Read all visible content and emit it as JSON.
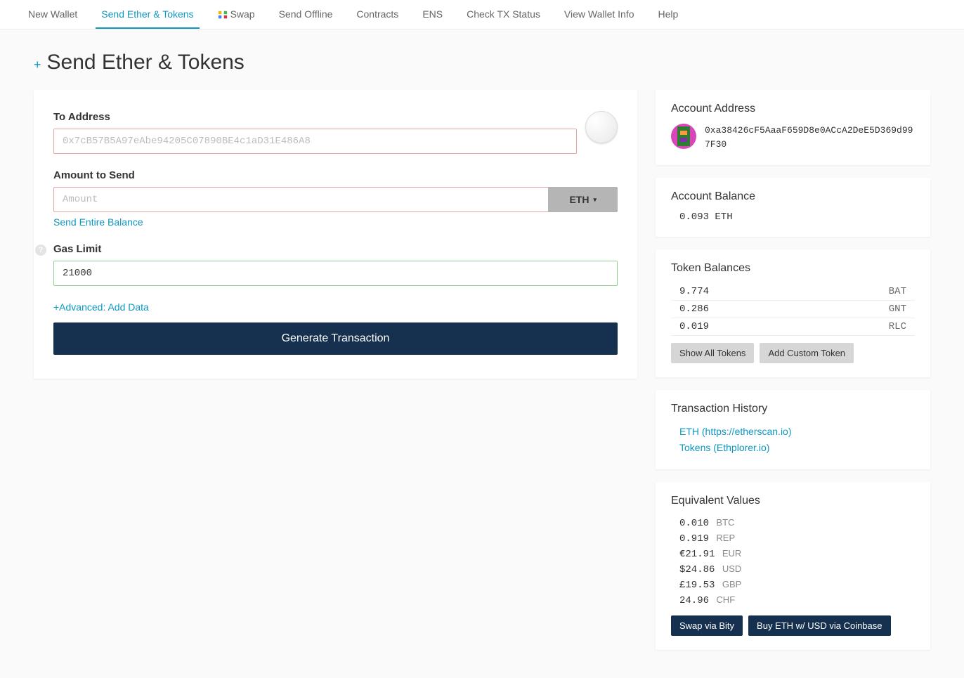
{
  "nav": {
    "items": [
      {
        "label": "New Wallet"
      },
      {
        "label": "Send Ether & Tokens"
      },
      {
        "label": "Swap"
      },
      {
        "label": "Send Offline"
      },
      {
        "label": "Contracts"
      },
      {
        "label": "ENS"
      },
      {
        "label": "Check TX Status"
      },
      {
        "label": "View Wallet Info"
      },
      {
        "label": "Help"
      }
    ]
  },
  "page": {
    "title": "Send Ether & Tokens"
  },
  "form": {
    "to_label": "To Address",
    "to_placeholder": "0x7cB57B5A97eAbe94205C07890BE4c1aD31E486A8",
    "to_value": "",
    "amount_label": "Amount to Send",
    "amount_placeholder": "Amount",
    "amount_value": "",
    "currency": "ETH",
    "send_entire": "Send Entire Balance",
    "gas_label": "Gas Limit",
    "gas_value": "21000",
    "advanced": "+Advanced: Add Data",
    "generate": "Generate Transaction"
  },
  "account": {
    "title": "Account Address",
    "address": "0xa38426cF5AaaF659D8e0ACcA2DeE5D369d997F30"
  },
  "balance": {
    "title": "Account Balance",
    "value": "0.093 ETH"
  },
  "tokens": {
    "title": "Token Balances",
    "rows": [
      {
        "amount": "9.774",
        "symbol": "BAT"
      },
      {
        "amount": "0.286",
        "symbol": "GNT"
      },
      {
        "amount": "0.019",
        "symbol": "RLC"
      }
    ],
    "show_all": "Show All Tokens",
    "add_custom": "Add Custom Token"
  },
  "history": {
    "title": "Transaction History",
    "links": [
      {
        "text": "ETH (https://etherscan.io)"
      },
      {
        "text": "Tokens (Ethplorer.io)"
      }
    ]
  },
  "equiv": {
    "title": "Equivalent Values",
    "rows": [
      {
        "value": "0.010",
        "cur": "BTC"
      },
      {
        "value": "0.919",
        "cur": "REP"
      },
      {
        "value": "€21.91",
        "cur": "EUR"
      },
      {
        "value": "$24.86",
        "cur": "USD"
      },
      {
        "value": "£19.53",
        "cur": "GBP"
      },
      {
        "value": "24.96",
        "cur": "CHF"
      }
    ],
    "swap": "Swap via Bity",
    "buy": "Buy ETH w/ USD via Coinbase"
  }
}
